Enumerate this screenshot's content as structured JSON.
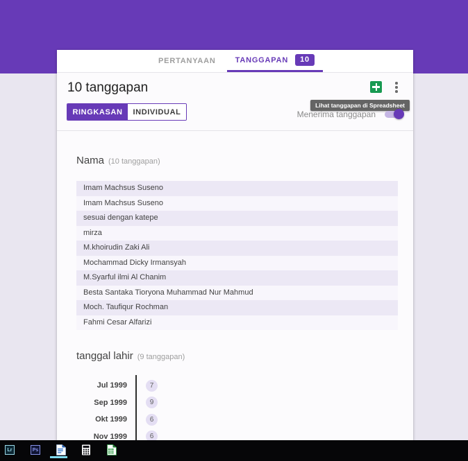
{
  "app": {
    "tabs": [
      {
        "label": "PERTANYAAN",
        "active": false
      },
      {
        "label": "TANGGAPAN",
        "active": true,
        "badge": "10"
      }
    ],
    "header": {
      "title": "10 tanggapan",
      "view_buttons": [
        {
          "label": "RINGKASAN",
          "active": true
        },
        {
          "label": "INDIVIDUAL",
          "active": false
        }
      ],
      "spreadsheet_tooltip": "Lihat tanggapan di Spreadsheet",
      "accepting_label": "Menerima tanggapan",
      "accepting_on": true
    },
    "sections": {
      "nama": {
        "title": "Nama",
        "count_label": "(10 tanggapan)",
        "responses": [
          "Imam Machsus Suseno",
          "Imam Machsus Suseno",
          "sesuai dengan katepe",
          "mirza",
          "M.khoirudin Zaki Ali",
          "Mochammad Dicky Irmansyah",
          "M.Syarful ilmi Al Chanim",
          "Besta Santaka Tioryona Muhammad Nur Mahmud",
          "Moch. Taufiqur Rochman",
          "Fahmi Cesar Alfarizi"
        ]
      },
      "tanggal_lahir": {
        "title": "tanggal lahir",
        "count_label": "(9 tanggapan)"
      }
    }
  },
  "chart_data": {
    "type": "bar",
    "orientation": "horizontal",
    "title": "tanggal lahir",
    "categories": [
      "Jul 1999",
      "Sep 1999",
      "Okt 1999",
      "Nov 1999"
    ],
    "values": [
      7,
      9,
      6,
      6
    ],
    "legend": "none",
    "grid": "off"
  },
  "taskbar": {
    "items": [
      {
        "name": "lightroom",
        "label": "Lr"
      },
      {
        "name": "photoshop",
        "label": "Ps"
      },
      {
        "name": "writer",
        "active": true
      },
      {
        "name": "calculator"
      },
      {
        "name": "calc-spreadsheet"
      }
    ]
  },
  "colors": {
    "accent_purple": "#673ab7",
    "band_purple": "#673ab7",
    "body_bg": "#e9e6f0",
    "row_stripe_dark": "#ece8f5",
    "row_stripe_light": "#f8f6fc",
    "sheets_green": "#189a52",
    "tooltip_bg": "#5e5e5e",
    "taskbar_bg": "#060608",
    "active_underline": "#7fdbf0"
  }
}
